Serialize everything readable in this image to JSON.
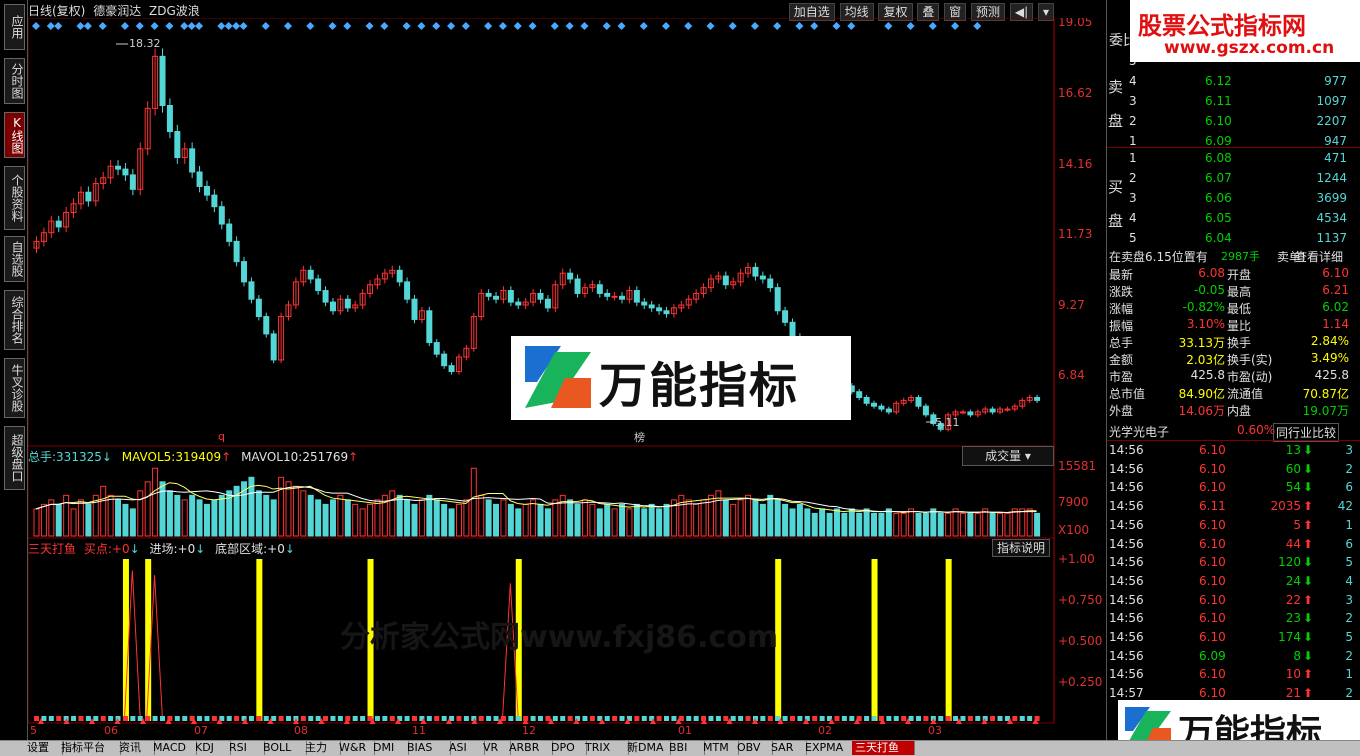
{
  "colors": {
    "up": "#ff3333",
    "down": "#55d6d6",
    "accent": "#c00000",
    "yellow": "#ffff00"
  },
  "leftnav": [
    {
      "label": "应用",
      "active": false
    },
    {
      "label": "分时图",
      "active": false
    },
    {
      "label": "K线图",
      "active": true
    },
    {
      "label": "个股资料",
      "active": false
    },
    {
      "label": "自选股",
      "active": false
    },
    {
      "label": "综合排名",
      "active": false
    },
    {
      "label": "牛叉诊股",
      "active": false
    },
    {
      "label": "超级盘口",
      "active": false
    }
  ],
  "header": {
    "title": "日线(复权)",
    "stock": "德豪润达",
    "indicator": "ZDG波浪"
  },
  "toolbar": {
    "add_fav": "加自选",
    "avg_line": "均线",
    "restore": "复权",
    "overlay": "叠",
    "window": "窗",
    "forecast": "预测"
  },
  "price_axis": [
    "19.05",
    "16.62",
    "14.16",
    "11.73",
    "9.27",
    "6.84"
  ],
  "price_annotations": {
    "high": "18.32",
    "low": "5.11",
    "q_mark": "q",
    "rank_mark": "榜"
  },
  "volume_header": {
    "total_label": "总手:",
    "total": "331325",
    "mavol5_label": "MAVOL5:",
    "mavol5": "319409",
    "mavol10_label": "MAVOL10:",
    "mavol10": "251769",
    "dropdown": "成交量"
  },
  "volume_axis": [
    "15581",
    "7900",
    "X100"
  ],
  "indicator_header": {
    "name": "三天打鱼",
    "buy_label": "买点:",
    "buy": "+0",
    "entry_label": "进场:",
    "entry": "+0",
    "bottom_label": "底部区域:",
    "bottom": "+0",
    "help": "指标说明"
  },
  "indicator_axis": [
    "+1.00",
    "+0.750",
    "+0.500",
    "+0.250"
  ],
  "date_labels": [
    "5",
    "06",
    "07",
    "08",
    "11",
    "12",
    "01",
    "02",
    "03"
  ],
  "watermark": {
    "main": "万能指标",
    "top_cn": "股票公式指标网",
    "top_url": "www.gszx.com.cn",
    "faint": "分析家公式网www.fxj86.com"
  },
  "orderbook": {
    "header": "委比",
    "sell_label": "卖盘",
    "buy_label": "买盘",
    "asks": [
      {
        "lvl": "5",
        "price": "",
        "vol": ""
      },
      {
        "lvl": "4",
        "price": "6.12",
        "vol": "977"
      },
      {
        "lvl": "3",
        "price": "6.11",
        "vol": "1097"
      },
      {
        "lvl": "2",
        "price": "6.10",
        "vol": "2207"
      },
      {
        "lvl": "1",
        "price": "6.09",
        "vol": "947"
      }
    ],
    "bids": [
      {
        "lvl": "1",
        "price": "6.08",
        "vol": "471"
      },
      {
        "lvl": "2",
        "price": "6.07",
        "vol": "1244"
      },
      {
        "lvl": "3",
        "price": "6.06",
        "vol": "3699"
      },
      {
        "lvl": "4",
        "price": "6.05",
        "vol": "4534"
      },
      {
        "lvl": "5",
        "price": "6.04",
        "vol": "1137"
      }
    ]
  },
  "notice": {
    "text": "在卖盘6.15位置有",
    "qty": "2987手",
    "type": "卖单!",
    "link": "查看详细"
  },
  "quote": [
    {
      "l1": "最新",
      "v1": "6.08",
      "c1": "red",
      "l2": "开盘",
      "v2": "6.10",
      "c2": "red"
    },
    {
      "l1": "涨跌",
      "v1": "-0.05",
      "c1": "green",
      "l2": "最高",
      "v2": "6.21",
      "c2": "red"
    },
    {
      "l1": "涨幅",
      "v1": "-0.82%",
      "c1": "green",
      "l2": "最低",
      "v2": "6.02",
      "c2": "green"
    },
    {
      "l1": "振幅",
      "v1": "3.10%",
      "c1": "red",
      "l2": "量比",
      "v2": "1.14",
      "c2": "red"
    },
    {
      "l1": "总手",
      "v1": "33.13万",
      "c1": "yellow",
      "l2": "换手",
      "v2": "2.84%",
      "c2": "yellow"
    },
    {
      "l1": "金额",
      "v1": "2.03亿",
      "c1": "yellow",
      "l2": "换手(实)",
      "v2": "3.49%",
      "c2": "yellow"
    },
    {
      "l1": "市盈",
      "v1": "425.8",
      "c1": "white",
      "l2": "市盈(动)",
      "v2": "425.8",
      "c2": "white"
    },
    {
      "l1": "总市值",
      "v1": "84.90亿",
      "c1": "yellow",
      "l2": "流通值",
      "v2": "70.87亿",
      "c2": "yellow"
    },
    {
      "l1": "外盘",
      "v1": "14.06万",
      "c1": "red",
      "l2": "内盘",
      "v2": "19.07万",
      "c2": "green"
    }
  ],
  "sector": {
    "name": "光学光电子",
    "change": "0.60%",
    "compare": "同行业比较"
  },
  "ticks": [
    {
      "t": "14:56",
      "p": "6.10",
      "v": "13",
      "d": "down",
      "n": "3"
    },
    {
      "t": "14:56",
      "p": "6.10",
      "v": "60",
      "d": "down",
      "n": "2"
    },
    {
      "t": "14:56",
      "p": "6.10",
      "v": "54",
      "d": "down",
      "n": "6"
    },
    {
      "t": "14:56",
      "p": "6.11",
      "v": "2035",
      "d": "up",
      "n": "42"
    },
    {
      "t": "14:56",
      "p": "6.10",
      "v": "5",
      "d": "up",
      "n": "1"
    },
    {
      "t": "14:56",
      "p": "6.10",
      "v": "44",
      "d": "up",
      "n": "6"
    },
    {
      "t": "14:56",
      "p": "6.10",
      "v": "120",
      "d": "down",
      "n": "5"
    },
    {
      "t": "14:56",
      "p": "6.10",
      "v": "24",
      "d": "down",
      "n": "4"
    },
    {
      "t": "14:56",
      "p": "6.10",
      "v": "22",
      "d": "up",
      "n": "3"
    },
    {
      "t": "14:56",
      "p": "6.10",
      "v": "23",
      "d": "down",
      "n": "2"
    },
    {
      "t": "14:56",
      "p": "6.10",
      "v": "174",
      "d": "down",
      "n": "5"
    },
    {
      "t": "14:56",
      "p": "6.09",
      "v": "8",
      "d": "down",
      "n": "2"
    },
    {
      "t": "14:56",
      "p": "6.10",
      "v": "10",
      "d": "up",
      "n": "1"
    },
    {
      "t": "14:57",
      "p": "6.10",
      "v": "21",
      "d": "up",
      "n": "2"
    }
  ],
  "bottom_tabs": [
    {
      "label": "设置",
      "active": false
    },
    {
      "label": "指标平台",
      "active": false
    },
    {
      "label": "资讯",
      "active": false
    },
    {
      "label": "MACD",
      "active": false
    },
    {
      "label": "KDJ",
      "active": false
    },
    {
      "label": "RSI",
      "active": false
    },
    {
      "label": "BOLL",
      "active": false
    },
    {
      "label": "主力",
      "active": false
    },
    {
      "label": "W&R",
      "active": false
    },
    {
      "label": "DMI",
      "active": false
    },
    {
      "label": "BIAS",
      "active": false
    },
    {
      "label": "ASI",
      "active": false
    },
    {
      "label": "VR",
      "active": false
    },
    {
      "label": "ARBR",
      "active": false
    },
    {
      "label": "DPO",
      "active": false
    },
    {
      "label": "TRIX",
      "active": false
    },
    {
      "label": "新DMA",
      "active": false
    },
    {
      "label": "BBI",
      "active": false
    },
    {
      "label": "MTM",
      "active": false
    },
    {
      "label": "OBV",
      "active": false
    },
    {
      "label": "SAR",
      "active": false
    },
    {
      "label": "EXPMA",
      "active": false
    },
    {
      "label": "三天打鱼",
      "active": true
    }
  ],
  "chart_data": [
    {
      "type": "candlestick",
      "title": "日线(复权) 德豪润达 ZDG波浪",
      "ylim": [
        5.0,
        19.05
      ],
      "closes": [
        11.6,
        11.9,
        12.3,
        12.1,
        12.6,
        12.9,
        13.3,
        13.0,
        13.6,
        13.8,
        14.2,
        14.1,
        13.9,
        13.4,
        14.8,
        16.2,
        18.0,
        16.3,
        15.4,
        14.5,
        14.8,
        14.0,
        13.5,
        13.2,
        12.8,
        12.2,
        11.6,
        10.9,
        10.2,
        9.6,
        9.0,
        8.4,
        7.5,
        9.0,
        9.4,
        10.2,
        10.6,
        10.3,
        9.9,
        9.5,
        9.2,
        9.6,
        9.3,
        9.4,
        9.8,
        10.1,
        10.3,
        10.5,
        10.6,
        10.2,
        9.6,
        8.9,
        9.2,
        8.1,
        7.7,
        7.3,
        7.1,
        7.6,
        7.9,
        9.0,
        9.8,
        9.7,
        9.6,
        9.9,
        9.5,
        9.4,
        9.5,
        9.8,
        9.6,
        9.3,
        10.1,
        10.5,
        10.3,
        9.8,
        10.0,
        10.1,
        9.8,
        9.7,
        9.7,
        9.6,
        9.9,
        9.5,
        9.4,
        9.3,
        9.2,
        9.1,
        9.3,
        9.4,
        9.6,
        9.8,
        10.0,
        10.3,
        10.4,
        10.1,
        10.2,
        10.5,
        10.7,
        10.4,
        10.3,
        10.0,
        9.2,
        8.8,
        8.3,
        7.9,
        7.6,
        7.2,
        7.0,
        6.8,
        6.7,
        6.6,
        6.4,
        6.2,
        6.0,
        5.9,
        5.8,
        5.7,
        6.0,
        6.1,
        6.2,
        5.9,
        5.6,
        5.3,
        5.1,
        5.6,
        5.7,
        5.7,
        5.6,
        5.7,
        5.8,
        5.7,
        5.8,
        5.8,
        5.9,
        6.1,
        6.2,
        6.1
      ]
    },
    {
      "type": "bar",
      "title": "成交量",
      "series": [
        {
          "name": "MAVOL5",
          "values": [
            319409
          ]
        },
        {
          "name": "MAVOL10",
          "values": [
            251769
          ]
        }
      ],
      "values": [
        6,
        7,
        8,
        7,
        9,
        6,
        8,
        7,
        9,
        11,
        9,
        8,
        7,
        6,
        10,
        12,
        15,
        12,
        10,
        9,
        8,
        9,
        8,
        7,
        8,
        9,
        10,
        11,
        12,
        13,
        10,
        9,
        8,
        13,
        12,
        11,
        10,
        9,
        8,
        7,
        8,
        9,
        8,
        7,
        6,
        7,
        8,
        9,
        10,
        9,
        8,
        7,
        8,
        9,
        8,
        7,
        6,
        7,
        8,
        15,
        9,
        8,
        7,
        8,
        7,
        6,
        7,
        8,
        7,
        6,
        8,
        9,
        8,
        7,
        8,
        7,
        6,
        7,
        6,
        7,
        6,
        7,
        6,
        7,
        6,
        7,
        8,
        9,
        8,
        7,
        8,
        9,
        10,
        8,
        7,
        8,
        9,
        8,
        7,
        9,
        8,
        7,
        6,
        7,
        6,
        5,
        6,
        5,
        6,
        5,
        6,
        5,
        6,
        5,
        5,
        6,
        5,
        5,
        6,
        5,
        5,
        6,
        5,
        5,
        6,
        5,
        5,
        5,
        6,
        5,
        5,
        5,
        6,
        6,
        6,
        5
      ]
    },
    {
      "type": "bar",
      "title": "三天打鱼",
      "ylim": [
        0,
        1.0
      ],
      "yticks": [
        "+1.00",
        "+0.750",
        "+0.500",
        "+0.250"
      ],
      "signal_positions": [
        12,
        15,
        30,
        45,
        65,
        100,
        113,
        123
      ],
      "spikes": [
        {
          "pos": 13,
          "value": 0.93
        },
        {
          "pos": 16,
          "value": 0.9
        },
        {
          "pos": 64,
          "value": 0.85
        }
      ]
    }
  ]
}
